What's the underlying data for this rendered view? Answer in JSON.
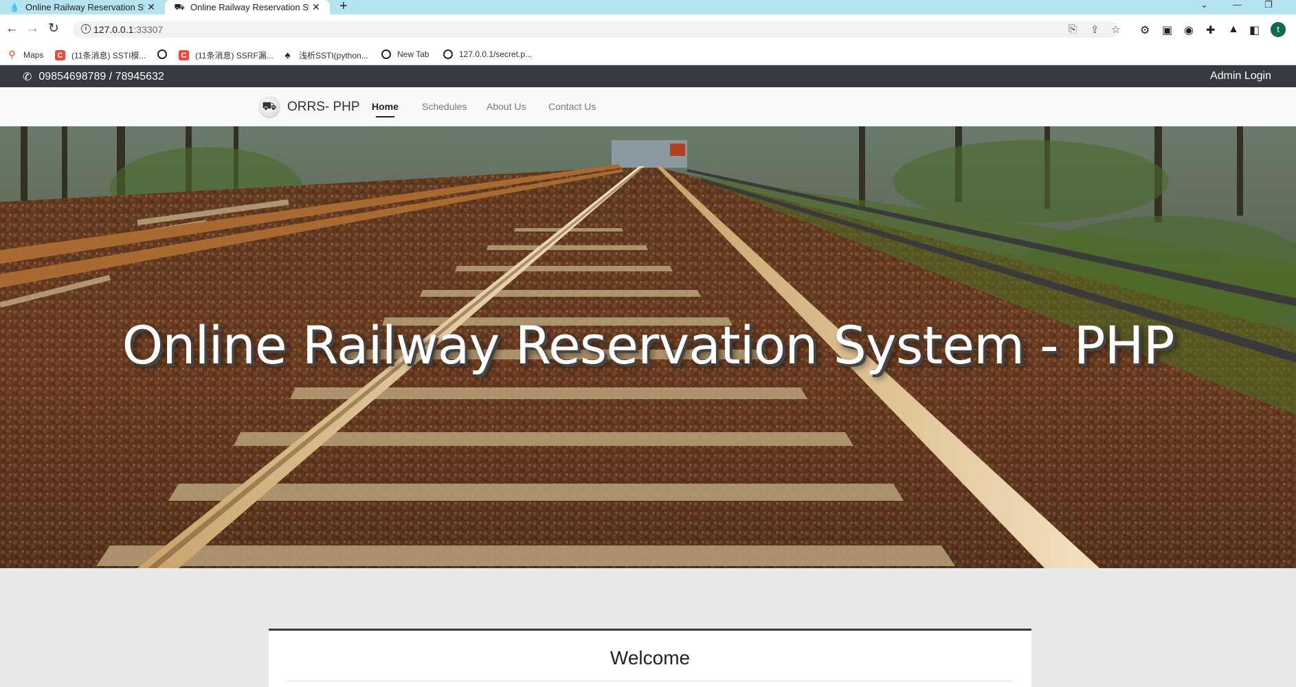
{
  "browser": {
    "tabs": [
      {
        "title": "Online Railway Reservation Sy",
        "icon": "drupal-drop-icon",
        "active": false
      },
      {
        "title": "Online Railway Reservation Sy",
        "icon": "train-logo-icon",
        "active": true
      }
    ],
    "url_host": "127.0.0.1",
    "url_port": ":33307",
    "bookmarks": [
      {
        "label": "Maps",
        "icon": "maps-pin-icon"
      },
      {
        "label": "(11条消息) SSTI模...",
        "icon": "csdn-icon"
      },
      {
        "label": "",
        "icon": "globe-icon"
      },
      {
        "label": "(11条消息) SSRF漏...",
        "icon": "csdn-icon"
      },
      {
        "label": "浅析SSTI(python...",
        "icon": "spade-icon"
      },
      {
        "label": "New Tab",
        "icon": "globe-icon"
      },
      {
        "label": "127.0.0.1/secret.p...",
        "icon": "globe-icon"
      }
    ],
    "profile_initial": "t"
  },
  "topbar": {
    "phone": "09854698789 / 78945632",
    "admin_login": "Admin Login"
  },
  "navbar": {
    "brand": "ORRS- PHP",
    "links": [
      {
        "label": "Home",
        "active": true
      },
      {
        "label": "Schedules",
        "active": false
      },
      {
        "label": "About Us",
        "active": false
      },
      {
        "label": "Contact Us",
        "active": false
      }
    ]
  },
  "hero": {
    "title": "Online Railway Reservation System - PHP"
  },
  "content": {
    "welcome": "Welcome"
  }
}
